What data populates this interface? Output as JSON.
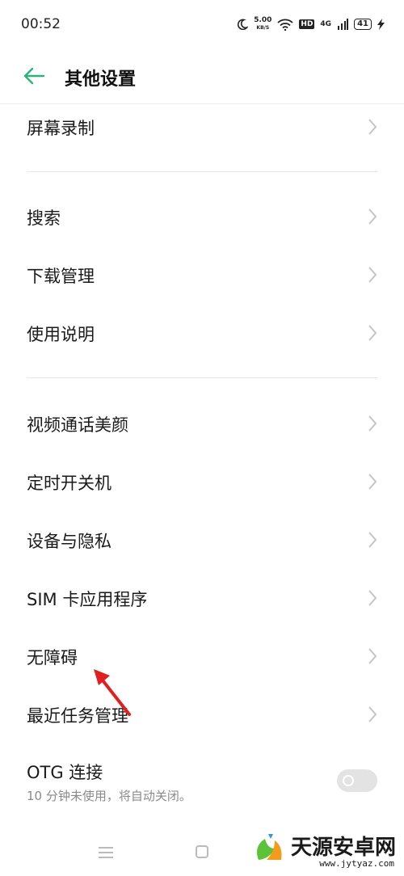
{
  "status_bar": {
    "time": "00:52",
    "speed_value": "5.00",
    "speed_unit": "KB/S",
    "hd": "HD",
    "network": "4G",
    "battery": "41"
  },
  "header": {
    "title": "其他设置"
  },
  "items": [
    {
      "label": "屏幕录制"
    },
    {
      "label": "搜索"
    },
    {
      "label": "下载管理"
    },
    {
      "label": "使用说明"
    },
    {
      "label": "视频通话美颜"
    },
    {
      "label": "定时开关机"
    },
    {
      "label": "设备与隐私"
    },
    {
      "label": "SIM 卡应用程序"
    },
    {
      "label": "无障碍"
    },
    {
      "label": "最近任务管理"
    }
  ],
  "otg": {
    "label": "OTG 连接",
    "subtitle": "10 分钟未使用，将自动关闭。",
    "enabled": false
  },
  "watermark": {
    "text": "天源安卓网",
    "url": "www.jytyaz.com"
  },
  "colors": {
    "accent": "#2db37a",
    "annotation_arrow": "#e02020"
  }
}
